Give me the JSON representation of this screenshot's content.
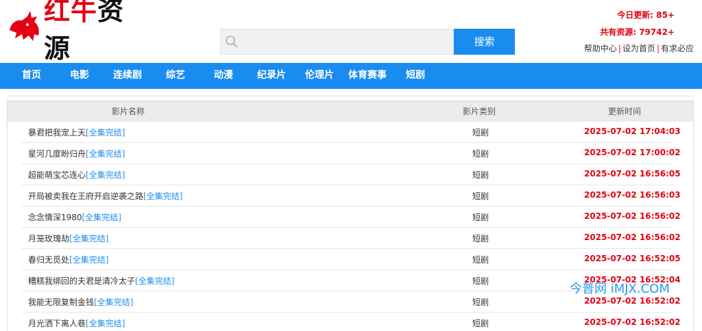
{
  "logo": {
    "brand_red": "红牛",
    "brand_dark": "资源"
  },
  "search": {
    "placeholder": "",
    "button_label": "搜索"
  },
  "stats": {
    "today_label": "今日更新:",
    "today_value": "85+",
    "total_label": "共有资源:",
    "total_value": "79742+"
  },
  "top_links": [
    "帮助中心",
    "设为首页",
    "有求必应"
  ],
  "top_links_sep": "|",
  "nav": [
    "首页",
    "电影",
    "连续剧",
    "综艺",
    "动漫",
    "纪录片",
    "伦理片",
    "体育赛事",
    "短剧"
  ],
  "table": {
    "headers": [
      "影片名称",
      "影片类别",
      "更新时间"
    ],
    "rows": [
      {
        "name": "暴君把我宠上天",
        "tag": "[全集完结]",
        "type": "短剧",
        "time": "2025-07-02 17:04:03"
      },
      {
        "name": "星河几度盼归舟",
        "tag": "[全集完结]",
        "type": "短剧",
        "time": "2025-07-02 17:00:02"
      },
      {
        "name": "超能萌宝芯连心",
        "tag": "[全集完结]",
        "type": "短剧",
        "time": "2025-07-02 16:56:05"
      },
      {
        "name": "开局被卖我在王府开启逆袭之路",
        "tag": "[全集完结]",
        "type": "短剧",
        "time": "2025-07-02 16:56:03"
      },
      {
        "name": "念念情深1980",
        "tag": "[全集完结]",
        "type": "短剧",
        "time": "2025-07-02 16:56:02"
      },
      {
        "name": "月笼玫瑰劫",
        "tag": "[全集完结]",
        "type": "短剧",
        "time": "2025-07-02 16:56:02"
      },
      {
        "name": "春归无觅处",
        "tag": "[全集完结]",
        "type": "短剧",
        "time": "2025-07-02 16:52:05"
      },
      {
        "name": "糟糕我绑回的夫君是清冷太子",
        "tag": "[全集完结]",
        "type": "短剧",
        "time": "2025-07-02 16:52:04"
      },
      {
        "name": "我能无限复制金钱",
        "tag": "[全集完结]",
        "type": "短剧",
        "time": "2025-07-02 16:52:02"
      },
      {
        "name": "月光洒下离人巷",
        "tag": "[全集完结]",
        "type": "短剧",
        "time": "2025-07-02 16:52:02"
      }
    ]
  },
  "watermark": "今普网 iMJX.COM",
  "colors": {
    "accent_blue": "#1a8cf0",
    "brand_red": "#e50012"
  }
}
